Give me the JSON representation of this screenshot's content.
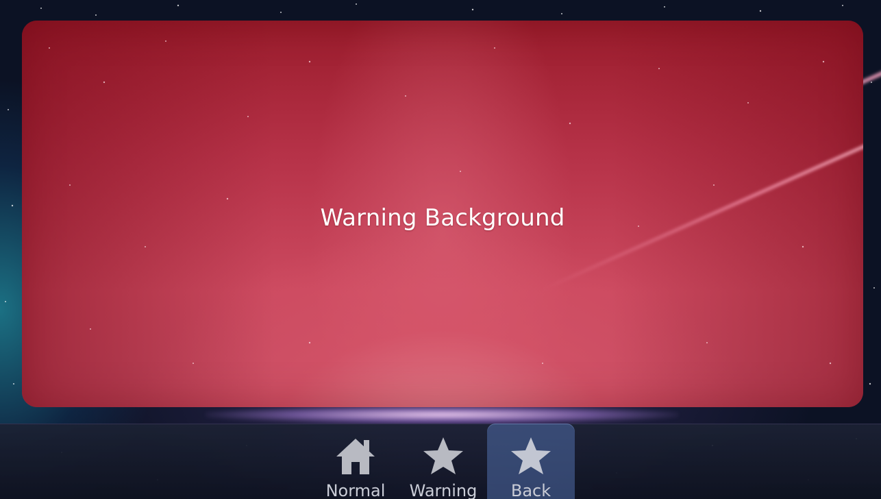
{
  "panel": {
    "title": "Warning Background",
    "color": "#b63248"
  },
  "nav": {
    "items": [
      {
        "label": "Normal",
        "icon": "home-icon",
        "active": false
      },
      {
        "label": "Warning",
        "icon": "star-icon",
        "active": false
      },
      {
        "label": "Back",
        "icon": "star-icon",
        "active": true
      }
    ]
  },
  "colors": {
    "background": "#0b1220",
    "active_tab": "#506eaa",
    "icon": "#b8bac2",
    "label": "#c9ccd6"
  }
}
